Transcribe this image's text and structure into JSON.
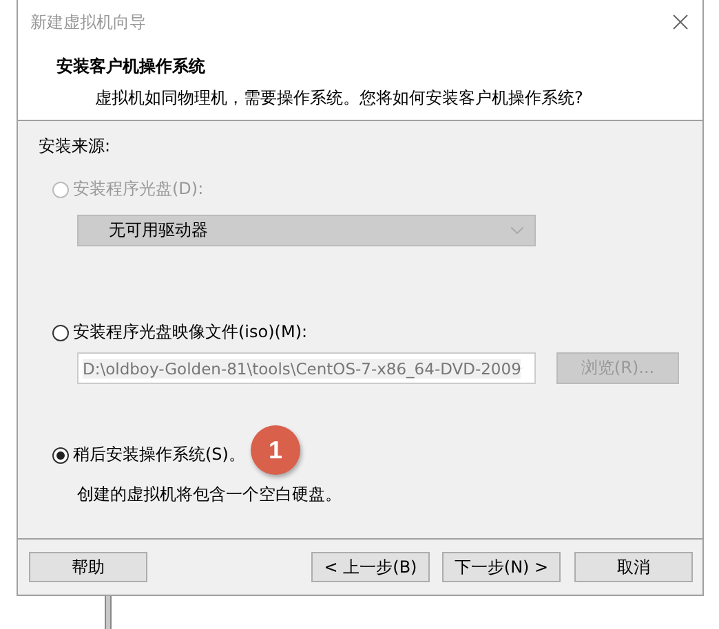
{
  "window": {
    "title": "新建虚拟机向导"
  },
  "header": {
    "title": "安装客户机操作系统",
    "subtitle": "虚拟机如同物理机，需要操作系统。您将如何安装客户机操作系统?"
  },
  "section_label": "安装来源:",
  "options": [
    {
      "kind": "disc",
      "label": "安装程序光盘(D):",
      "selected": false,
      "disabled": true,
      "dropdown": {
        "value": "无可用驱动器",
        "disabled": true
      }
    },
    {
      "kind": "iso",
      "label": "安装程序光盘映像文件(iso)(M):",
      "selected": false,
      "disabled": false,
      "dropdown": {
        "value": "D:\\oldboy-Golden-81\\tools\\CentOS-7-x86_64-DVD-2009",
        "disabled": true
      },
      "browse_button": {
        "label": "浏览(R)...",
        "disabled": true
      }
    },
    {
      "kind": "later",
      "label": "稍后安装操作系统(S)。",
      "selected": true,
      "disabled": false,
      "description": "创建的虚拟机将包含一个空白硬盘。"
    }
  ],
  "annotation": {
    "label": "1"
  },
  "buttons": [
    {
      "label": "帮助"
    },
    {
      "label": "< 上一步(B)"
    },
    {
      "label": "下一步(N) >"
    },
    {
      "label": "取消"
    }
  ]
}
